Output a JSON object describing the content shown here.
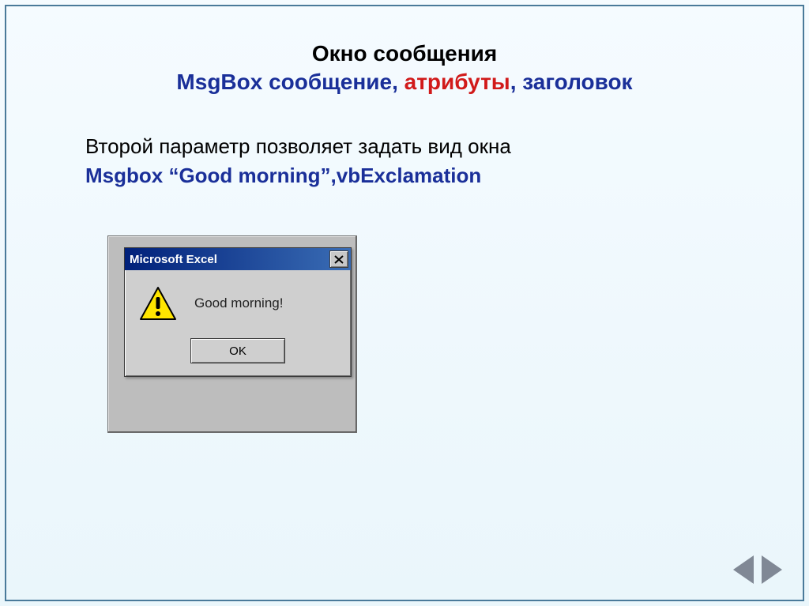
{
  "heading": {
    "line1": "Окно сообщения",
    "line2_pre": "MsgBox сообщение, ",
    "line2_attrib": "атрибуты",
    "line2_post": ", заголовок"
  },
  "body": {
    "line1": "Второй параметр позволяет задать вид окна",
    "line2": "Msgbox “Good morning”,vbExclamation"
  },
  "dialog": {
    "title": "Microsoft Excel",
    "message": "Good morning!",
    "ok_label": "OK"
  }
}
